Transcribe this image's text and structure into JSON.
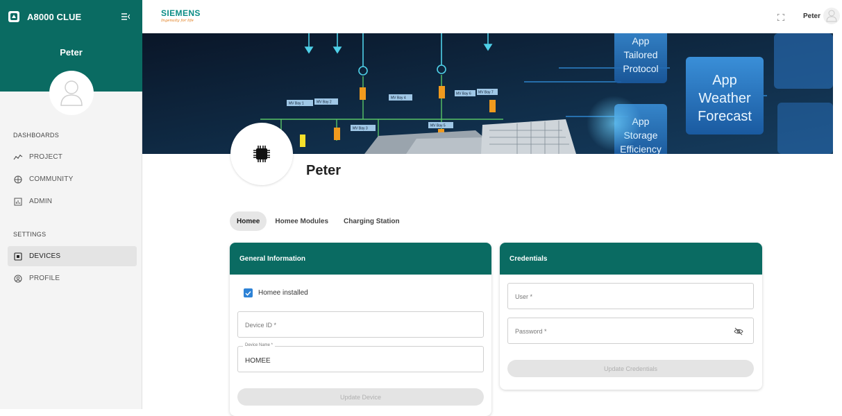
{
  "sidebar": {
    "app_name": "A8000 CLUE",
    "user_name": "Peter",
    "sections": {
      "dashboards": "DASHBOARDS",
      "settings": "SETTINGS"
    },
    "items": [
      {
        "label": "PROJECT",
        "icon": "trend-line-icon"
      },
      {
        "label": "COMMUNITY",
        "icon": "globe-icon"
      },
      {
        "label": "ADMIN",
        "icon": "admin-chart-icon"
      },
      {
        "label": "DEVICES",
        "icon": "chip-icon",
        "active": true
      },
      {
        "label": "PROFILE",
        "icon": "user-circle-icon"
      }
    ]
  },
  "topbar": {
    "brand": "SIEMENS",
    "brand_tagline": "Ingenuity for life",
    "user_name": "Peter"
  },
  "banner": {
    "labels": {
      "app1": [
        "App",
        "Tailored",
        "Protocol"
      ],
      "app2": [
        "App",
        "Weather",
        "Forecast"
      ],
      "app3": [
        "App",
        "Storage",
        "Efficiency"
      ],
      "bays": [
        "MV Bay 1",
        "MV Bay 2",
        "MV Bay 3",
        "MV Bay 4",
        "MV Bay 5",
        "MV Bay 6",
        "MV Bay 7"
      ]
    }
  },
  "profile": {
    "name": "Peter"
  },
  "tabs": [
    {
      "label": "Homee",
      "active": true
    },
    {
      "label": "Homee Modules"
    },
    {
      "label": "Charging Station"
    }
  ],
  "general_info": {
    "title": "General Information",
    "installed_label": "Homee installed",
    "installed": true,
    "device_id_placeholder": "Device ID *",
    "device_name_label": "Device Name *",
    "device_name_value": "HOMEE",
    "update_button": "Update Device"
  },
  "credentials": {
    "title": "Credentials",
    "user_placeholder": "User *",
    "password_placeholder": "Password *",
    "update_button": "Update Credentials"
  },
  "colors": {
    "primary": "#0a6b62",
    "checkbox": "#2d82d6",
    "brand": "#0a8c85"
  }
}
